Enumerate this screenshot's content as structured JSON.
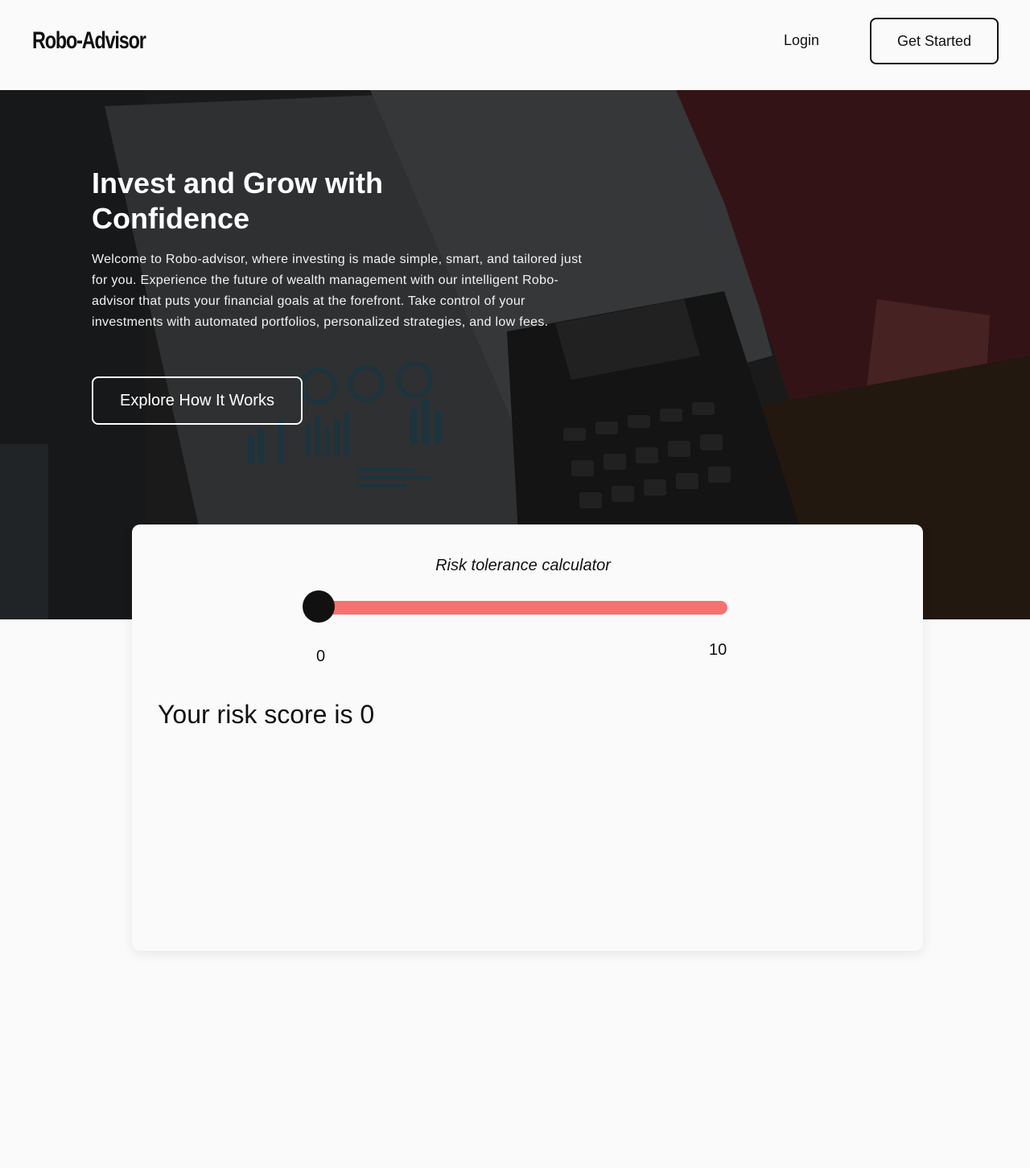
{
  "header": {
    "logo": "Robo-Advisor",
    "login_label": "Login",
    "get_started_label": "Get Started"
  },
  "hero": {
    "title": "Invest and Grow with Confidence",
    "description": "Welcome to Robo-advisor, where investing is made simple, smart, and tailored just for you. Experience the future of wealth management with our intelligent Robo-advisor that puts your financial goals at the forefront. Take control of your investments with automated portfolios, personalized strategies, and low fees.",
    "cta_label": "Explore How It Works"
  },
  "calculator": {
    "title": "Risk tolerance calculator",
    "slider_min": "0",
    "slider_max": "10",
    "slider_value": 0,
    "track_color": "#f87171",
    "thumb_color": "#111111",
    "score_text": "Your risk score is 0"
  }
}
